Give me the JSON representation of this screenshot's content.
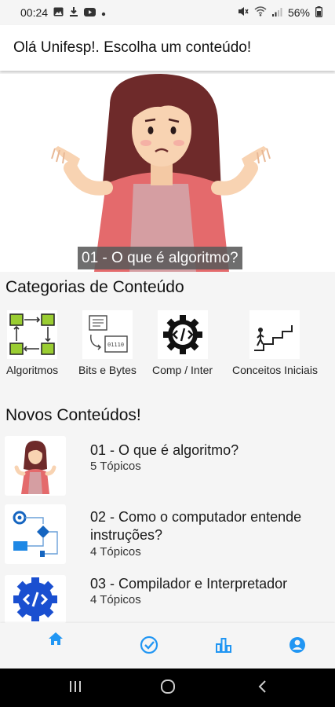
{
  "status_bar": {
    "time": "00:24",
    "battery": "56%",
    "icons_left": [
      "gallery-icon",
      "download-icon",
      "youtube-icon",
      "dot-icon"
    ],
    "icons_right": [
      "mute-icon",
      "wifi-icon",
      "signal-icon",
      "battery-icon"
    ]
  },
  "appbar": {
    "title": "Olá Unifesp!. Escolha um conteúdo!"
  },
  "hero": {
    "caption": "01 - O que é algoritmo?",
    "image": "confused-woman-illustration"
  },
  "categories": {
    "title": "Categorias de Conteúdo",
    "items": [
      {
        "label": "Algoritmos",
        "icon": "cycle-boxes-icon"
      },
      {
        "label": "Bits e Bytes",
        "icon": "computer-bits-icon"
      },
      {
        "label": "Comp / Inter",
        "icon": "code-gear-icon"
      },
      {
        "label": "Conceitos Iniciais",
        "icon": "stairs-climber-icon"
      }
    ]
  },
  "new_contents": {
    "title": "Novos Conteúdos!",
    "items": [
      {
        "title": "01 - O que é algoritmo?",
        "subtitle": "5 Tópicos",
        "thumb": "confused-woman-thumb"
      },
      {
        "title": "02 - Como o computador entende instruções?",
        "subtitle": "4 Tópicos",
        "thumb": "flowchart-thumb"
      },
      {
        "title": "03 - Compilador e Interpretador",
        "subtitle": "4 Tópicos",
        "thumb": "blue-code-gear-thumb"
      }
    ]
  },
  "bottom_nav": {
    "items": [
      "home-icon",
      "check-circle-icon",
      "bar-chart-icon",
      "account-icon"
    ],
    "active": "home-icon",
    "active_color": "#2196f3",
    "color": "#2196f3"
  },
  "system_nav": [
    "recents-icon",
    "home-circle-icon",
    "back-icon"
  ]
}
